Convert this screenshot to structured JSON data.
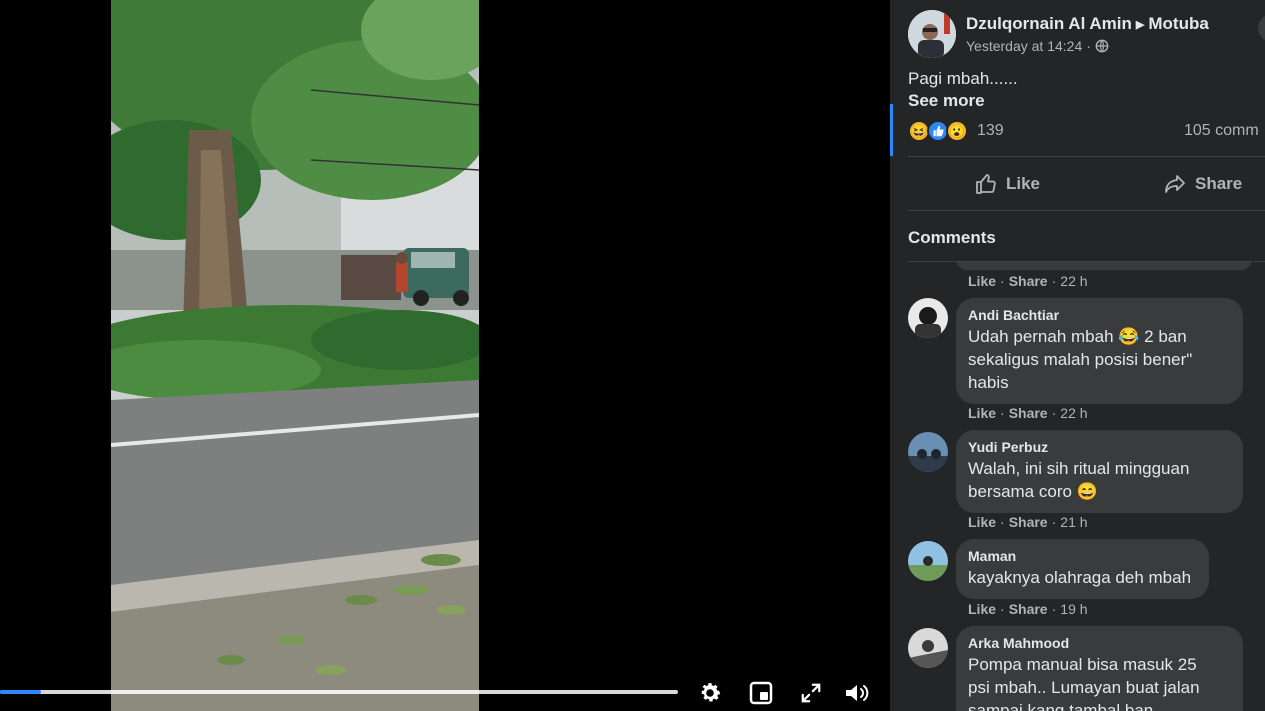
{
  "video": {
    "progress_fraction": 0.06,
    "controls": {
      "settings": "gear-icon",
      "pip": "picture-in-picture-icon",
      "fullscreen": "fullscreen-icon",
      "volume": "volume-icon"
    }
  },
  "post": {
    "author": "Dzulqornain Al Amin",
    "group": "Motuba",
    "timestamp": "Yesterday at 14:24",
    "audience_icon": "globe-icon",
    "text": "Pagi mbah......",
    "see_more": "See more",
    "reaction_count": "139",
    "comment_count": "105 comm",
    "reactions": [
      "haha",
      "like",
      "wow"
    ]
  },
  "actions": {
    "like": "Like",
    "share": "Share"
  },
  "comments_heading": "Comments",
  "comment_action_labels": {
    "like": "Like",
    "share": "Share"
  },
  "top_comment_time": "22 h",
  "comments": [
    {
      "name": "Andi Bachtiar",
      "lines": [
        "Udah pernah mbah 😂 2 ban",
        "sekaligus malah posisi bener\"",
        "habis"
      ],
      "time": "22 h"
    },
    {
      "name": "Yudi Perbuz",
      "lines": [
        "Walah, ini sih ritual mingguan",
        "bersama coro 😄"
      ],
      "time": "21 h"
    },
    {
      "name": "Maman",
      "lines": [
        "kayaknya olahraga deh mbah"
      ],
      "time": "19 h"
    },
    {
      "name": "Arka Mahmood",
      "lines": [
        "Pompa manual bisa masuk 25",
        "psi mbah.. Lumayan buat jalan",
        "sampai kang tambal ban"
      ]
    }
  ],
  "colors": {
    "panel_bg": "#242526",
    "bubble_bg": "#3a3b3c",
    "accent": "#2d88ff",
    "text_primary": "#e4e6eb",
    "text_secondary": "#b0b3b8"
  }
}
